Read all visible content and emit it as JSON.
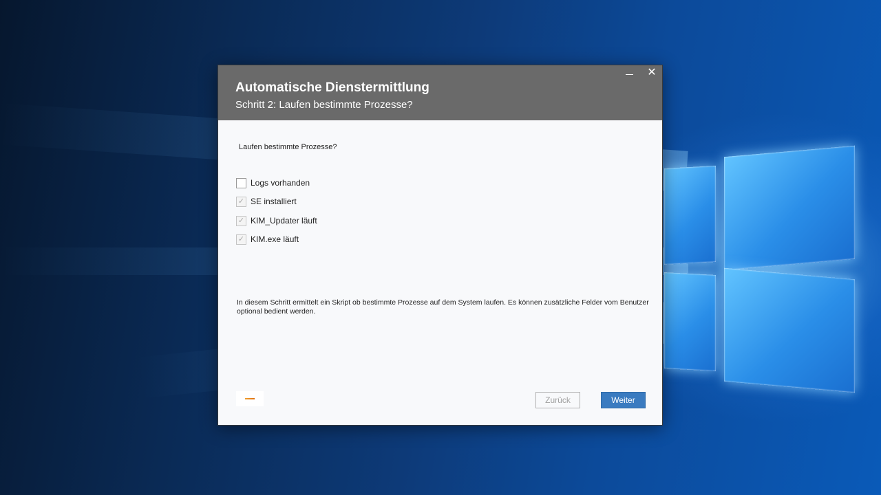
{
  "dialog": {
    "title": "Automatische Dienstermittlung",
    "subtitle": "Schritt 2: Laufen bestimmte Prozesse?",
    "minimize_icon": "minimize-icon",
    "close_label": "✕"
  },
  "content": {
    "question": "Laufen bestimmte Prozesse?",
    "checkboxes": [
      {
        "label": "Logs vorhanden",
        "checked": false
      },
      {
        "label": "SE installiert",
        "checked": true
      },
      {
        "label": "KIM_Updater läuft",
        "checked": true
      },
      {
        "label": "KIM.exe läuft",
        "checked": true
      }
    ],
    "info": "In diesem Schritt ermittelt ein Skript ob bestimmte Prozesse auf dem System laufen. Es können zusätzliche Felder vom Benutzer optional bedient werden."
  },
  "footer": {
    "back_label": "Zurück",
    "next_label": "Weiter"
  },
  "colors": {
    "header_bg": "#6a6a6a",
    "primary_button": "#3a7bc0",
    "desktop_bg": "#0a3a7a"
  }
}
